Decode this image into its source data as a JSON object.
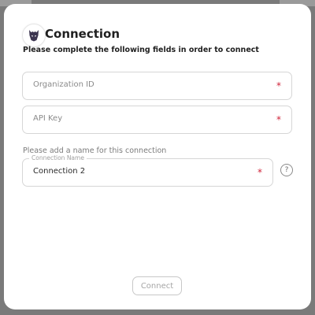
{
  "dialog": {
    "title": "Connection",
    "subtitle": "Please complete the following fields in order to connect",
    "logo_icon": "dark-knight-helmet-icon"
  },
  "fields": {
    "organization_id": {
      "placeholder": "Organization ID",
      "required_mark": "*"
    },
    "api_key": {
      "placeholder": "API Key",
      "required_mark": "*"
    },
    "connection_name": {
      "hint": "Please add a name for this connection",
      "label": "Connection Name",
      "value": "Connection 2",
      "required_mark": "*",
      "help_label": "?"
    }
  },
  "actions": {
    "connect_label": "Connect"
  },
  "colors": {
    "required": "#d0243a",
    "backdrop": "#7a7a7a"
  }
}
